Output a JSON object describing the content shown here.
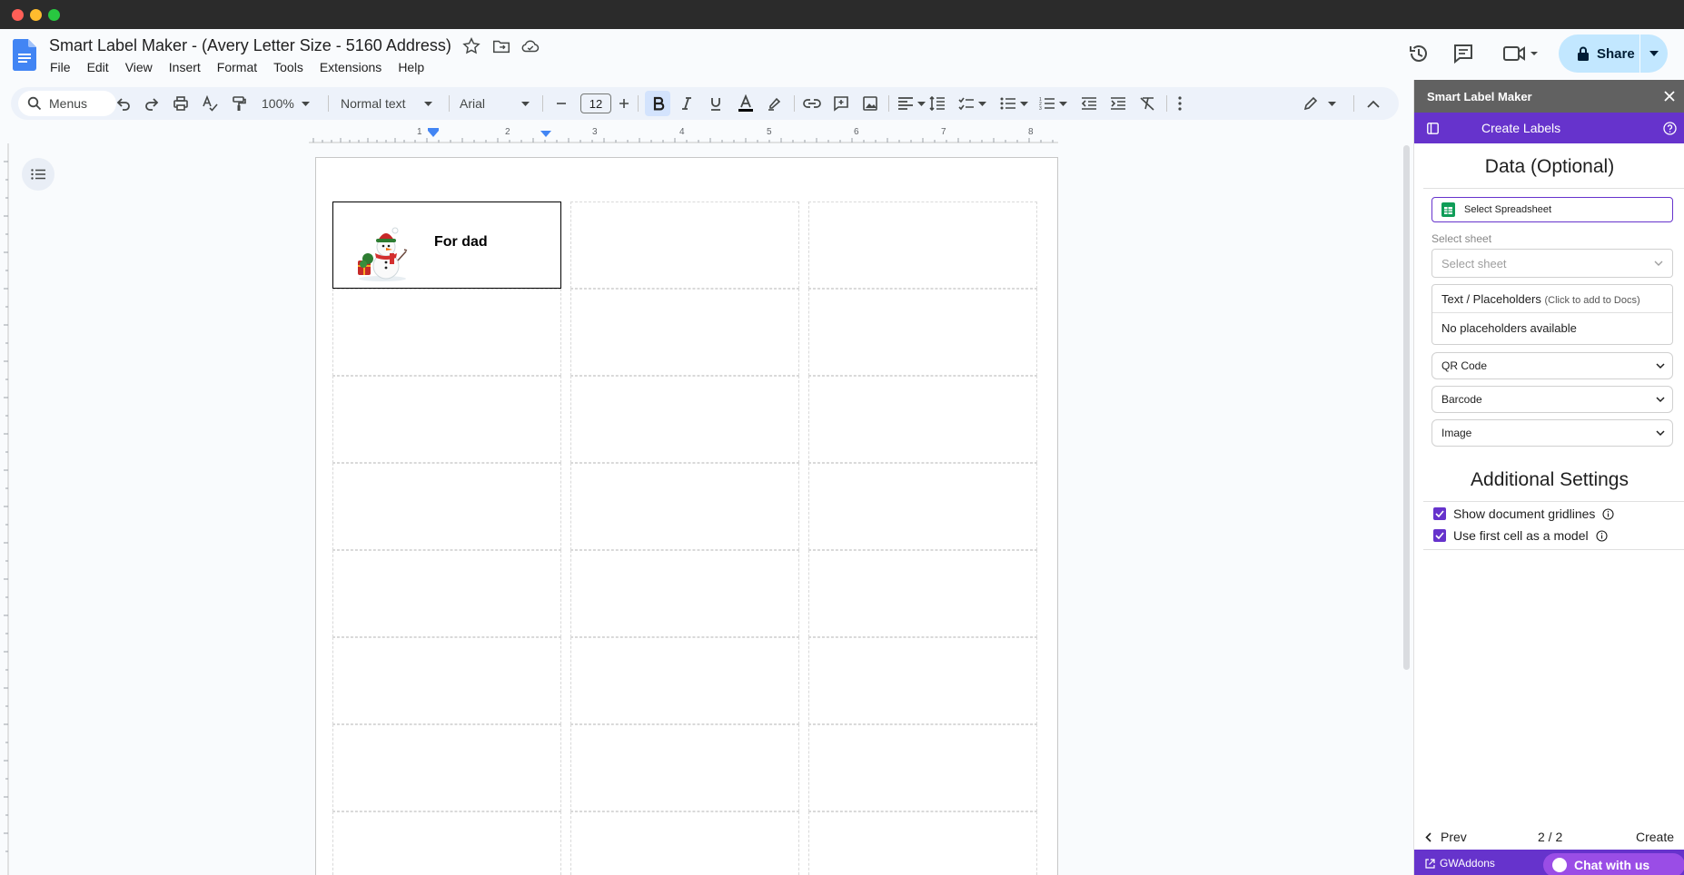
{
  "doc": {
    "title": "Smart Label Maker - (Avery Letter Size - 5160 Address)",
    "menu": [
      "File",
      "Edit",
      "View",
      "Insert",
      "Format",
      "Tools",
      "Extensions",
      "Help"
    ],
    "share_label": "Share"
  },
  "toolbar": {
    "search_label": "Menus",
    "zoom": "100%",
    "style": "Normal text",
    "font": "Arial",
    "font_size": "12"
  },
  "ruler": {
    "numbers": [
      "1",
      "2",
      "3",
      "4",
      "5",
      "6",
      "7",
      "8"
    ]
  },
  "label": {
    "text": "For dad"
  },
  "panel": {
    "title": "Smart Label Maker",
    "nav_label": "Create Labels",
    "data_heading": "Data (Optional)",
    "select_spreadsheet": "Select Spreadsheet",
    "select_sheet_label": "Select sheet",
    "select_sheet_placeholder": "Select sheet",
    "placeholders_title": "Text / Placeholders",
    "placeholders_hint": "(Click to add to Docs)",
    "placeholders_empty": "No placeholders available",
    "qr_code": "QR Code",
    "barcode": "Barcode",
    "image": "Image",
    "settings_heading": "Additional Settings",
    "show_gridlines": "Show document gridlines",
    "use_first_cell": "Use first cell as a model",
    "prev": "Prev",
    "page_indicator": "2 / 2",
    "create": "Create",
    "gwaddons": "GWAddons",
    "chat": "Chat with us"
  },
  "colors": {
    "accent": "#6633cc",
    "share": "#c2e7ff",
    "panel_header": "#616161"
  }
}
